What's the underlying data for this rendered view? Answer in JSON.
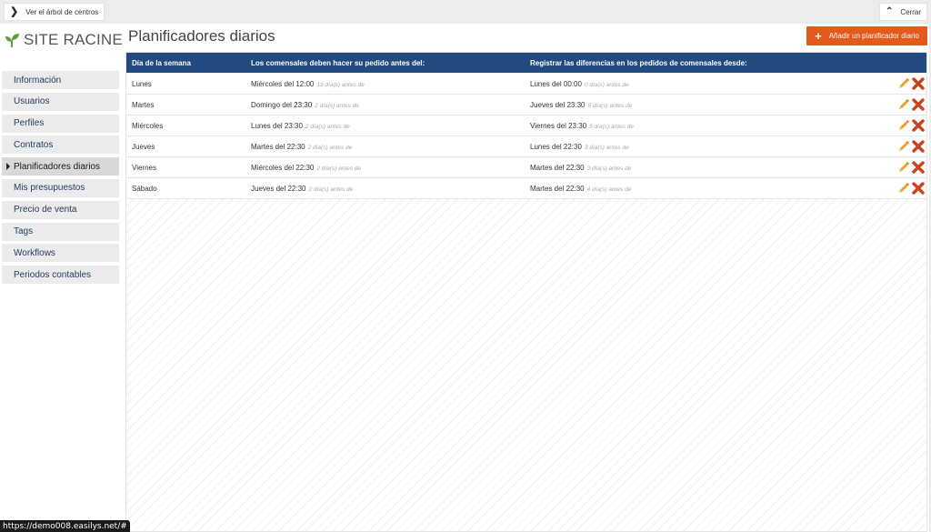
{
  "topbar": {
    "tree_label": "Ver el árbol de centros",
    "close_label": "Cerrar"
  },
  "logo": {
    "text": "SITE RACINE",
    "icon": "sprout-icon",
    "color": "#5aa13c"
  },
  "sidebar": {
    "items": [
      {
        "label": "Información",
        "active": false
      },
      {
        "label": "Usuarios",
        "active": false
      },
      {
        "label": "Perfiles",
        "active": false
      },
      {
        "label": "Contratos",
        "active": false
      },
      {
        "label": "Planificadores diarios",
        "active": true
      },
      {
        "label": "Mis presupuestos",
        "active": false
      },
      {
        "label": "Precio de venta",
        "active": false
      },
      {
        "label": "Tags",
        "active": false
      },
      {
        "label": "Workflows",
        "active": false
      },
      {
        "label": "Periodos contables",
        "active": false
      }
    ]
  },
  "main": {
    "title": "Planificadores diarios",
    "add_button": "Añadir un planificador diario",
    "accent": "#e35a1b",
    "header_color": "#234a7e"
  },
  "table": {
    "headers": [
      "Día de la semana",
      "Los comensales deben hacer su pedido antes del:",
      "Registrar las diferencias en los pedidos de comensales desde:"
    ],
    "rows": [
      {
        "day": "Lunes",
        "order": "Miércoles del 12:00",
        "order_note": "19 día(s) antes de",
        "diff": "Lunes del 00:00",
        "diff_note": "0 día(s) antes de"
      },
      {
        "day": "Martes",
        "order": "Domingo del 23:30",
        "order_note": "2 día(s) antes de",
        "diff": "Jueves del 23:30",
        "diff_note": "5 día(s) antes de"
      },
      {
        "day": "Miércoles",
        "order": "Lunes del 23:30",
        "order_note": "2 día(s) antes de",
        "diff": "Viernes del 23:30",
        "diff_note": "5 día(s) antes de"
      },
      {
        "day": "Jueves",
        "order": "Martes del 22:30",
        "order_note": "2 día(s) antes de",
        "diff": "Lunes del 22:30",
        "diff_note": "3 día(s) antes de"
      },
      {
        "day": "Viernes",
        "order": "Miércoles del 22:30",
        "order_note": "2 día(s) antes de",
        "diff": "Martes del 22:30",
        "diff_note": "3 día(s) antes de"
      },
      {
        "day": "Sábado",
        "order": "Jueves del 22:30",
        "order_note": "2 día(s) antes de",
        "diff": "Martes del 22:30",
        "diff_note": "4 día(s) antes de"
      }
    ],
    "row_icons": [
      "pencil-icon",
      "delete-x-icon"
    ]
  },
  "statusbar": {
    "url": "https://demo008.easilys.net/#"
  }
}
